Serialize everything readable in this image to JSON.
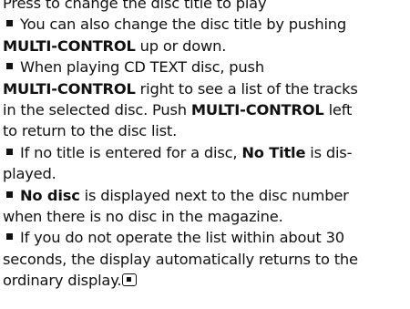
{
  "lines": {
    "l0": "   Press to change the disc title to play",
    "b1_a": "You can also change the disc title by pushing",
    "b1_b_bold": "MULTI-CONTROL",
    "b1_b_rest": " up or down.",
    "b2_a": "When playing CD TEXT disc, push",
    "b2_b_bold": "MULTI-CONTROL",
    "b2_b_rest": " right to see a list of the tracks",
    "b2_c": "in the selected disc. Push ",
    "b2_c_bold": "MULTI-CONTROL",
    "b2_c_rest": " left",
    "b2_d": "to return to the disc list.",
    "b3_a": "If no title is entered for a disc, ",
    "b3_a_bold": "No Title",
    "b3_a_rest": " is dis-",
    "b3_b": "played.",
    "b4_a_bold": "No disc",
    "b4_a_rest": " is displayed next to the disc number",
    "b4_b": "when there is no disc in the magazine.",
    "b5_a": "If you do not operate the list within about 30",
    "b5_b": "seconds, the display automatically returns to the",
    "b5_c": "ordinary display."
  },
  "icons": {
    "bullet": "bullet-square-icon",
    "end": "end-of-section-icon"
  }
}
